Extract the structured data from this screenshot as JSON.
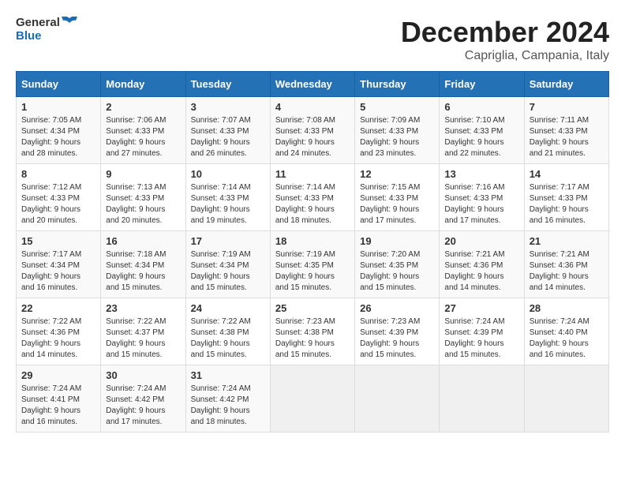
{
  "logo": {
    "line1": "General",
    "line2": "Blue"
  },
  "title": "December 2024",
  "location": "Capriglia, Campania, Italy",
  "days_header": [
    "Sunday",
    "Monday",
    "Tuesday",
    "Wednesday",
    "Thursday",
    "Friday",
    "Saturday"
  ],
  "weeks": [
    [
      {
        "day": "1",
        "sunrise": "7:05 AM",
        "sunset": "4:34 PM",
        "daylight": "9 hours and 28 minutes."
      },
      {
        "day": "2",
        "sunrise": "7:06 AM",
        "sunset": "4:33 PM",
        "daylight": "9 hours and 27 minutes."
      },
      {
        "day": "3",
        "sunrise": "7:07 AM",
        "sunset": "4:33 PM",
        "daylight": "9 hours and 26 minutes."
      },
      {
        "day": "4",
        "sunrise": "7:08 AM",
        "sunset": "4:33 PM",
        "daylight": "9 hours and 24 minutes."
      },
      {
        "day": "5",
        "sunrise": "7:09 AM",
        "sunset": "4:33 PM",
        "daylight": "9 hours and 23 minutes."
      },
      {
        "day": "6",
        "sunrise": "7:10 AM",
        "sunset": "4:33 PM",
        "daylight": "9 hours and 22 minutes."
      },
      {
        "day": "7",
        "sunrise": "7:11 AM",
        "sunset": "4:33 PM",
        "daylight": "9 hours and 21 minutes."
      }
    ],
    [
      {
        "day": "8",
        "sunrise": "7:12 AM",
        "sunset": "4:33 PM",
        "daylight": "9 hours and 20 minutes."
      },
      {
        "day": "9",
        "sunrise": "7:13 AM",
        "sunset": "4:33 PM",
        "daylight": "9 hours and 20 minutes."
      },
      {
        "day": "10",
        "sunrise": "7:14 AM",
        "sunset": "4:33 PM",
        "daylight": "9 hours and 19 minutes."
      },
      {
        "day": "11",
        "sunrise": "7:14 AM",
        "sunset": "4:33 PM",
        "daylight": "9 hours and 18 minutes."
      },
      {
        "day": "12",
        "sunrise": "7:15 AM",
        "sunset": "4:33 PM",
        "daylight": "9 hours and 17 minutes."
      },
      {
        "day": "13",
        "sunrise": "7:16 AM",
        "sunset": "4:33 PM",
        "daylight": "9 hours and 17 minutes."
      },
      {
        "day": "14",
        "sunrise": "7:17 AM",
        "sunset": "4:33 PM",
        "daylight": "9 hours and 16 minutes."
      }
    ],
    [
      {
        "day": "15",
        "sunrise": "7:17 AM",
        "sunset": "4:34 PM",
        "daylight": "9 hours and 16 minutes."
      },
      {
        "day": "16",
        "sunrise": "7:18 AM",
        "sunset": "4:34 PM",
        "daylight": "9 hours and 15 minutes."
      },
      {
        "day": "17",
        "sunrise": "7:19 AM",
        "sunset": "4:34 PM",
        "daylight": "9 hours and 15 minutes."
      },
      {
        "day": "18",
        "sunrise": "7:19 AM",
        "sunset": "4:35 PM",
        "daylight": "9 hours and 15 minutes."
      },
      {
        "day": "19",
        "sunrise": "7:20 AM",
        "sunset": "4:35 PM",
        "daylight": "9 hours and 15 minutes."
      },
      {
        "day": "20",
        "sunrise": "7:21 AM",
        "sunset": "4:36 PM",
        "daylight": "9 hours and 14 minutes."
      },
      {
        "day": "21",
        "sunrise": "7:21 AM",
        "sunset": "4:36 PM",
        "daylight": "9 hours and 14 minutes."
      }
    ],
    [
      {
        "day": "22",
        "sunrise": "7:22 AM",
        "sunset": "4:36 PM",
        "daylight": "9 hours and 14 minutes."
      },
      {
        "day": "23",
        "sunrise": "7:22 AM",
        "sunset": "4:37 PM",
        "daylight": "9 hours and 15 minutes."
      },
      {
        "day": "24",
        "sunrise": "7:22 AM",
        "sunset": "4:38 PM",
        "daylight": "9 hours and 15 minutes."
      },
      {
        "day": "25",
        "sunrise": "7:23 AM",
        "sunset": "4:38 PM",
        "daylight": "9 hours and 15 minutes."
      },
      {
        "day": "26",
        "sunrise": "7:23 AM",
        "sunset": "4:39 PM",
        "daylight": "9 hours and 15 minutes."
      },
      {
        "day": "27",
        "sunrise": "7:24 AM",
        "sunset": "4:39 PM",
        "daylight": "9 hours and 15 minutes."
      },
      {
        "day": "28",
        "sunrise": "7:24 AM",
        "sunset": "4:40 PM",
        "daylight": "9 hours and 16 minutes."
      }
    ],
    [
      {
        "day": "29",
        "sunrise": "7:24 AM",
        "sunset": "4:41 PM",
        "daylight": "9 hours and 16 minutes."
      },
      {
        "day": "30",
        "sunrise": "7:24 AM",
        "sunset": "4:42 PM",
        "daylight": "9 hours and 17 minutes."
      },
      {
        "day": "31",
        "sunrise": "7:24 AM",
        "sunset": "4:42 PM",
        "daylight": "9 hours and 18 minutes."
      },
      null,
      null,
      null,
      null
    ]
  ],
  "labels": {
    "sunrise": "Sunrise: ",
    "sunset": "Sunset: ",
    "daylight": "Daylight: "
  }
}
